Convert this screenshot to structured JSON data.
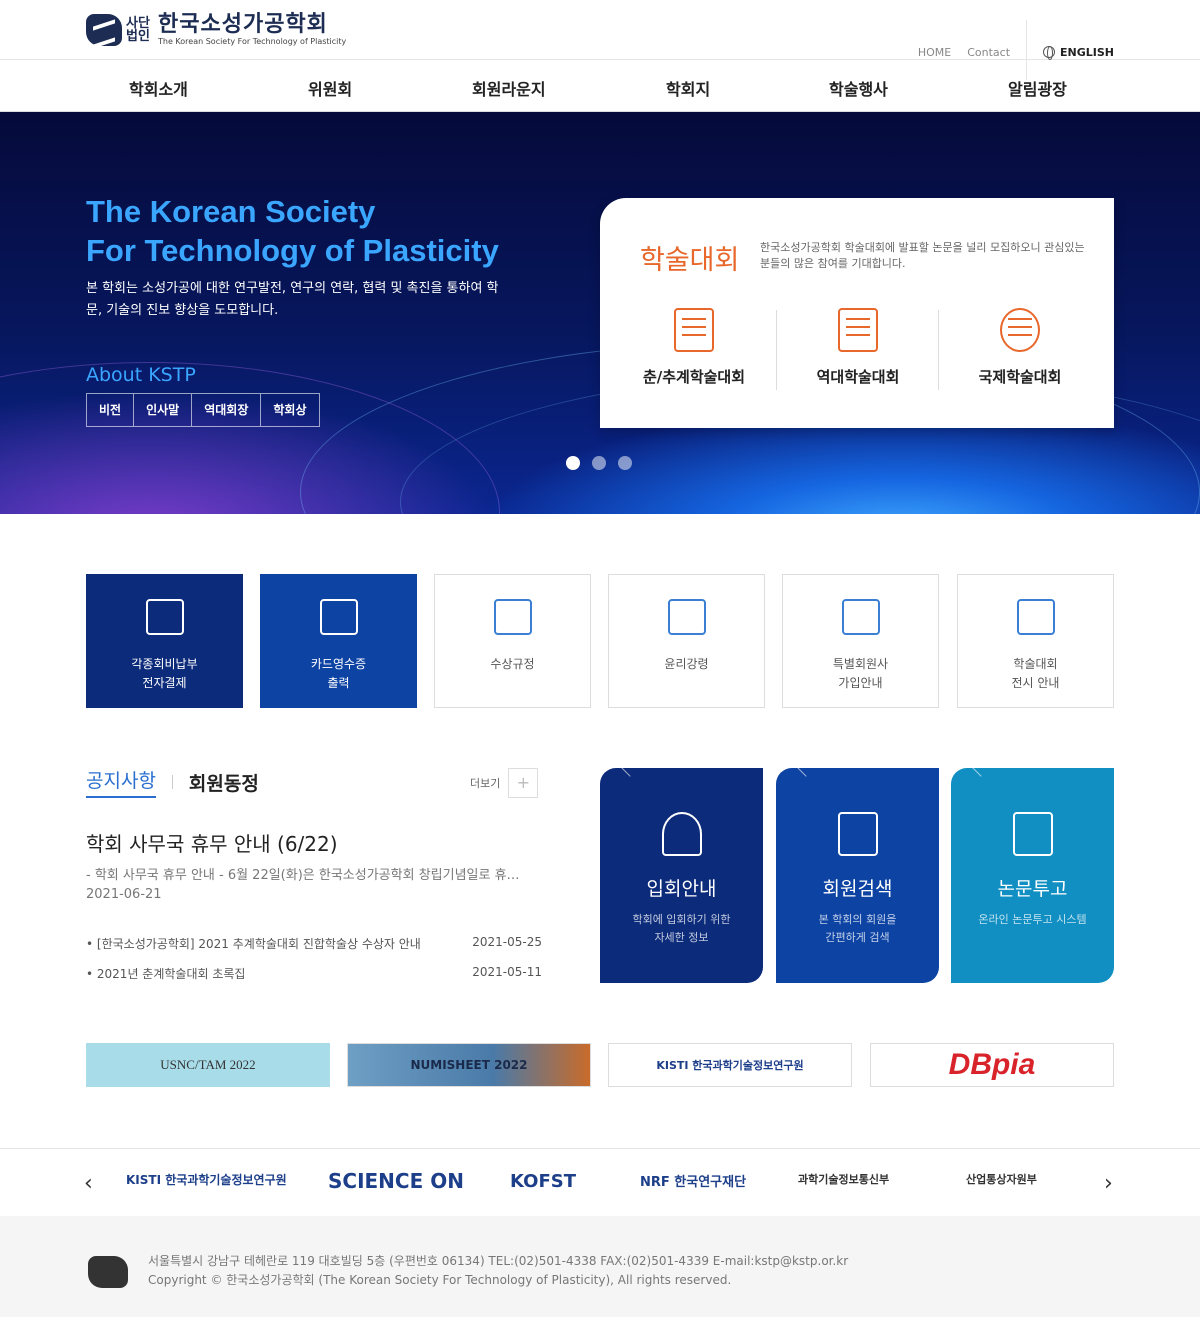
{
  "header": {
    "logo_type": "사단법인",
    "logo_name": "한국소성가공학회",
    "logo_sub": "The Korean Society For Technology of Plasticity",
    "util": [
      "HOME",
      "Contact"
    ],
    "english": "ENGLISH"
  },
  "gnb": [
    "학회소개",
    "위원회",
    "회원라운지",
    "학회지",
    "학술행사",
    "알림광장"
  ],
  "hero": {
    "title_line1": "The Korean Society",
    "title_line2": "For Technology of Plasticity",
    "desc": "본 학회는 소성가공에 대한 연구발전, 연구의 연락, 협력 및 촉진을 통하여 학문, 기술의 진보 향상을 도모합니다.",
    "about_title": "About KSTP",
    "about_links": [
      "비전",
      "인사말",
      "역대회장",
      "학회상"
    ],
    "slide_count": 3,
    "active_slide": 1
  },
  "conference": {
    "title": "학술대회",
    "desc": "한국소성가공학회 학술대회에 발표할 논문을 널리 모집하오니 관심있는 분들의 많은 참여를 기대합니다.",
    "items": [
      {
        "label": "춘/추계학술대회",
        "icon": "document-icon"
      },
      {
        "label": "역대학술대회",
        "icon": "search-document-icon"
      },
      {
        "label": "국제학술대회",
        "icon": "globe-gear-icon"
      }
    ]
  },
  "quick": [
    {
      "label": "각종회비납부\n전자결제",
      "icon": "money-icon"
    },
    {
      "label": "카드영수증\n출력",
      "icon": "receipt-icon"
    },
    {
      "label": "수상규정",
      "icon": "award-document-icon"
    },
    {
      "label": "윤리강령",
      "icon": "monitor-pen-icon"
    },
    {
      "label": "특별회원사\n가입안내",
      "icon": "members-icon"
    },
    {
      "label": "학술대회\n전시 안내",
      "icon": "exhibition-icon"
    }
  ],
  "notice": {
    "tab_active": "공지사항",
    "tab_other": "회원동정",
    "more": "더보기",
    "featured_title": "학회 사무국 휴무 안내 (6/22)",
    "featured_summary": "- 학회 사무국 휴무 안내 - 6월 22일(화)은 한국소성가공학회 창립기념일로 휴…",
    "featured_date": "2021-06-21",
    "rows": [
      {
        "title": "[한국소성가공학회] 2021 추계학술대회 진합학술상 수상자 안내",
        "date": "2021-05-25"
      },
      {
        "title": "2021년 춘계학술대회 초록집",
        "date": "2021-05-11"
      }
    ]
  },
  "cards": [
    {
      "title": "입회안내",
      "desc": "학회에 입회하기 위한\n자세한 정보",
      "color": "#0c2b7a",
      "icon": "people-icon"
    },
    {
      "title": "회원검색",
      "desc": "본 학회의 회원을\n간편하게 검색",
      "color": "#0d43a3",
      "icon": "id-card-icon"
    },
    {
      "title": "논문투고",
      "desc": "온라인 논문투고 시스템",
      "color": "#118fc2",
      "icon": "paper-submit-icon"
    }
  ],
  "banners": [
    "USNC/TAM 2022",
    "NUMISHEET 2022",
    "KISTI 한국과학기술정보연구원",
    "DBpia"
  ],
  "partners": [
    "KISTI 한국과학기술정보연구원",
    "SCIENCE ON",
    "KOFST",
    "NRF 한국연구재단",
    "과학기술정보통신부",
    "산업통상자원부"
  ],
  "footer": {
    "line1": "서울특별시 강남구 테헤란로 119 대호빌딩 5층 (우편번호 06134)    TEL:(02)501-4338    FAX:(02)501-4339    E-mail:kstp@kstp.or.kr",
    "line2": "Copyright © 한국소성가공학회 (The Korean Society For Technology of Plasticity), All rights reserved."
  }
}
